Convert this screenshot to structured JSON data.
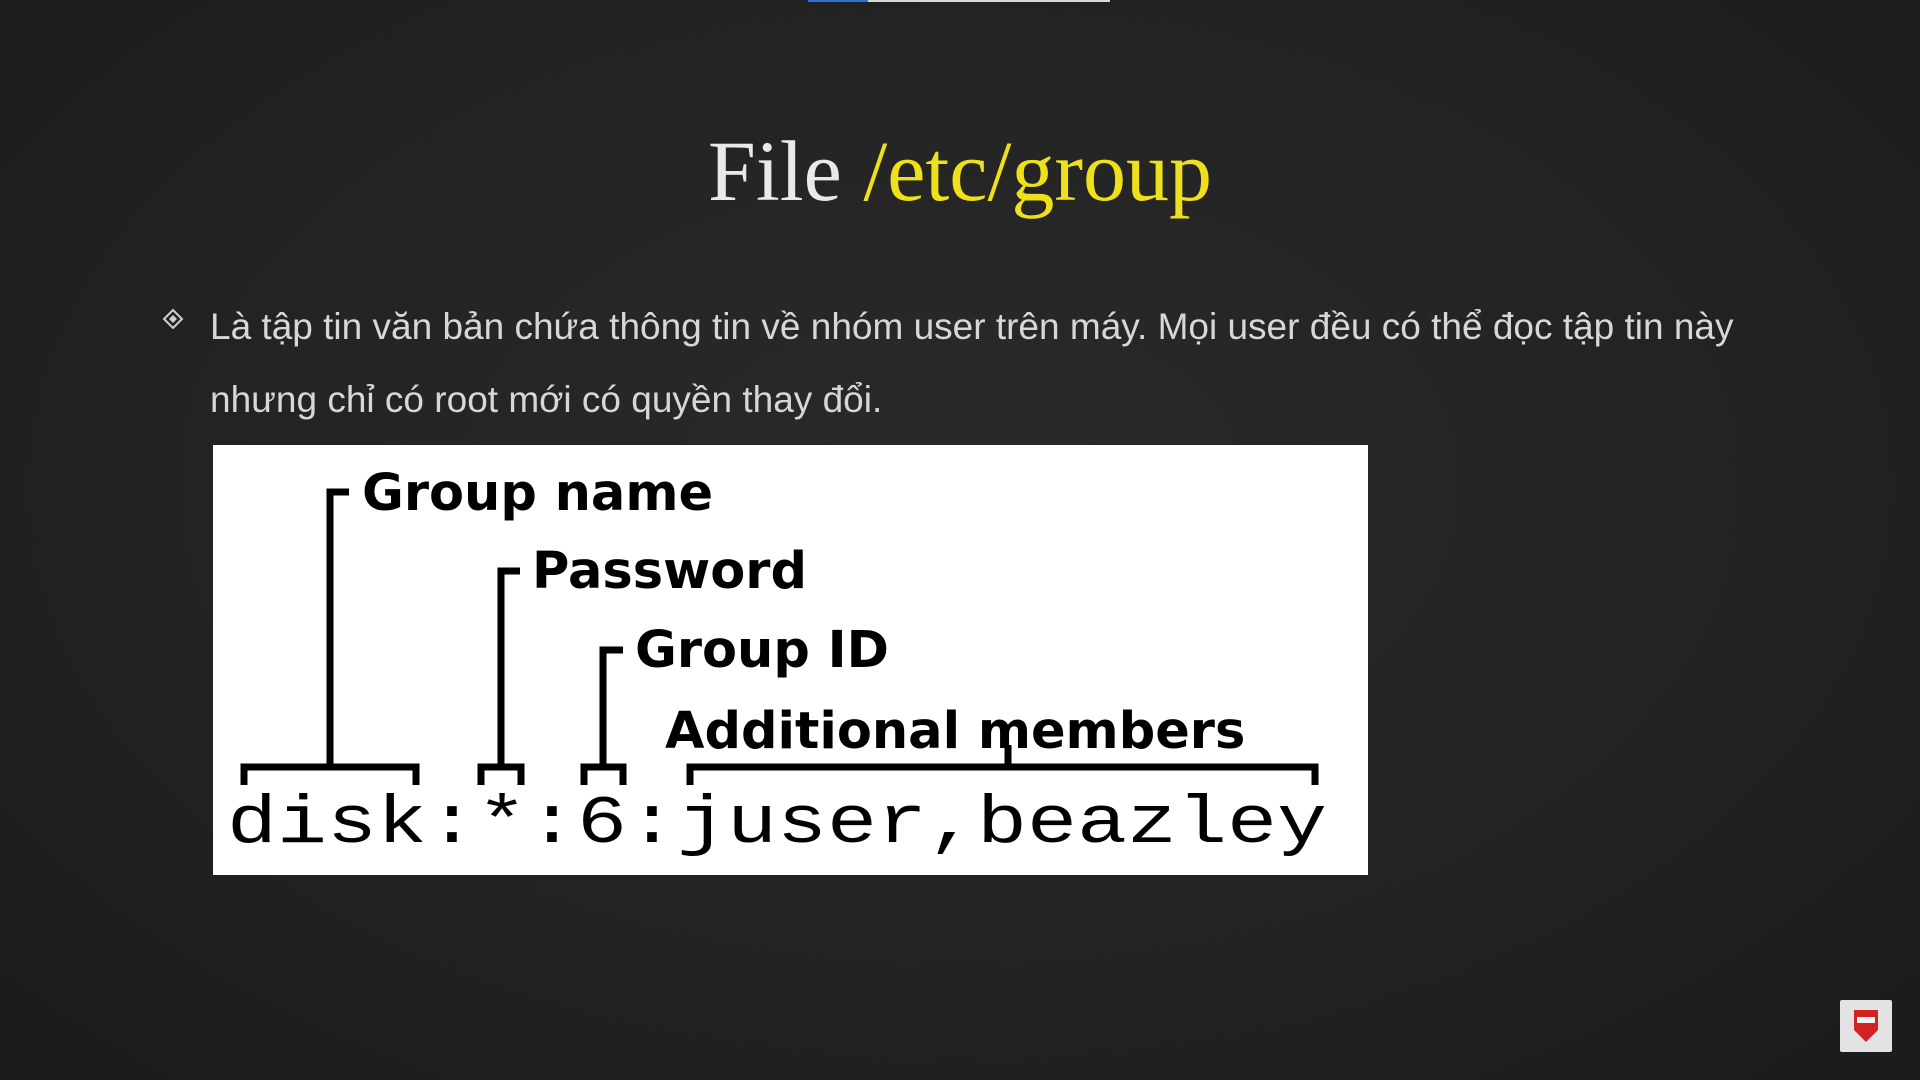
{
  "video": {
    "progress_fraction": 0.2
  },
  "slide": {
    "title_prefix": "File",
    "title_path": "/etc/group",
    "bullet": "Là tập tin văn bản chứa thông tin về nhóm user trên máy. Mọi user đều có thể đọc tập tin này nhưng chỉ có root mới có quyền thay đổi.",
    "figure": {
      "labels": {
        "group_name": "Group name",
        "password": "Password",
        "group_id": "Group ID",
        "additional_members": "Additional members"
      },
      "example_line": "disk:*:6:juser,beazley"
    }
  },
  "colors": {
    "accent": "#eee01a",
    "text": "#d7d7d7",
    "background": "#232323"
  },
  "icons": {
    "bullet": "diamond-bullet-icon",
    "corner": "channel-logo-icon"
  }
}
